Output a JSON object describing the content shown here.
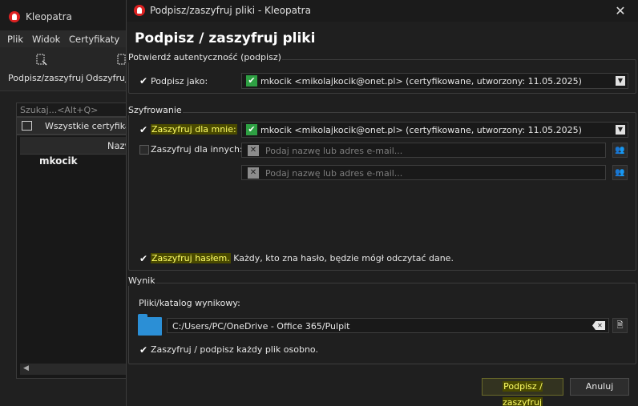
{
  "main_window": {
    "title": "Kleopatra",
    "menu": [
      "Plik",
      "Widok",
      "Certyfikaty"
    ],
    "toolbar": {
      "sign_encrypt_label": "Podpisz/zaszyfruj",
      "decrypt_label": "Odszyfruj"
    },
    "search_placeholder": "Szukaj...<Alt+Q>",
    "filter_label": "Wszystkie certyfikaty",
    "table_header_name": "Nazw",
    "rows": [
      "mkocik"
    ]
  },
  "dialog": {
    "title": "Podpisz/zaszyfruj pliki - Kleopatra",
    "heading": "Podpisz / zaszyfruj pliki",
    "sign_group": {
      "title": "Potwierdź autentyczność (podpisz)",
      "sign_as_label": "Podpisz jako:",
      "sign_as_value": "mkocik <mikolajkocik@onet.pl> (certyfikowane, utworzony: 11.05.2025)"
    },
    "encrypt_group": {
      "title": "Szyfrowanie",
      "encrypt_for_me_label": "Zaszyfruj dla mnie:",
      "encrypt_for_me_value": "mkocik <mikolajkocik@onet.pl> (certyfikowane, utworzony: 11.05.2025)",
      "encrypt_for_others_label": "Zaszyfruj dla innych:",
      "recipient_placeholder_1": "Podaj nazwę lub adres e-mail...",
      "recipient_placeholder_2": "Podaj nazwę lub adres e-mail...",
      "password_label": "Zaszyfruj hasłem.",
      "password_note": " Każdy, kto zna hasło, będzie mógł odczytać dane."
    },
    "output_group": {
      "title": "Wynik",
      "dir_label": "Pliki/katalog wynikowy:",
      "path": "C:/Users/PC/OneDrive - Office 365/Pulpit",
      "each_file_label": "Zaszyfruj / podpisz każdy plik osobno."
    },
    "buttons": {
      "primary": "Podpisz / zaszyfruj",
      "cancel": "Anuluj"
    },
    "checkbox_states": {
      "sign_as": true,
      "encrypt_for_me": true,
      "encrypt_for_others": false,
      "encrypt_password": true,
      "each_file": true
    }
  },
  "colors": {
    "highlight_bg": "#4a4a00",
    "highlight_fg": "#ffff66",
    "ok_badge": "#2ea043",
    "folder": "#2b8fd6"
  }
}
